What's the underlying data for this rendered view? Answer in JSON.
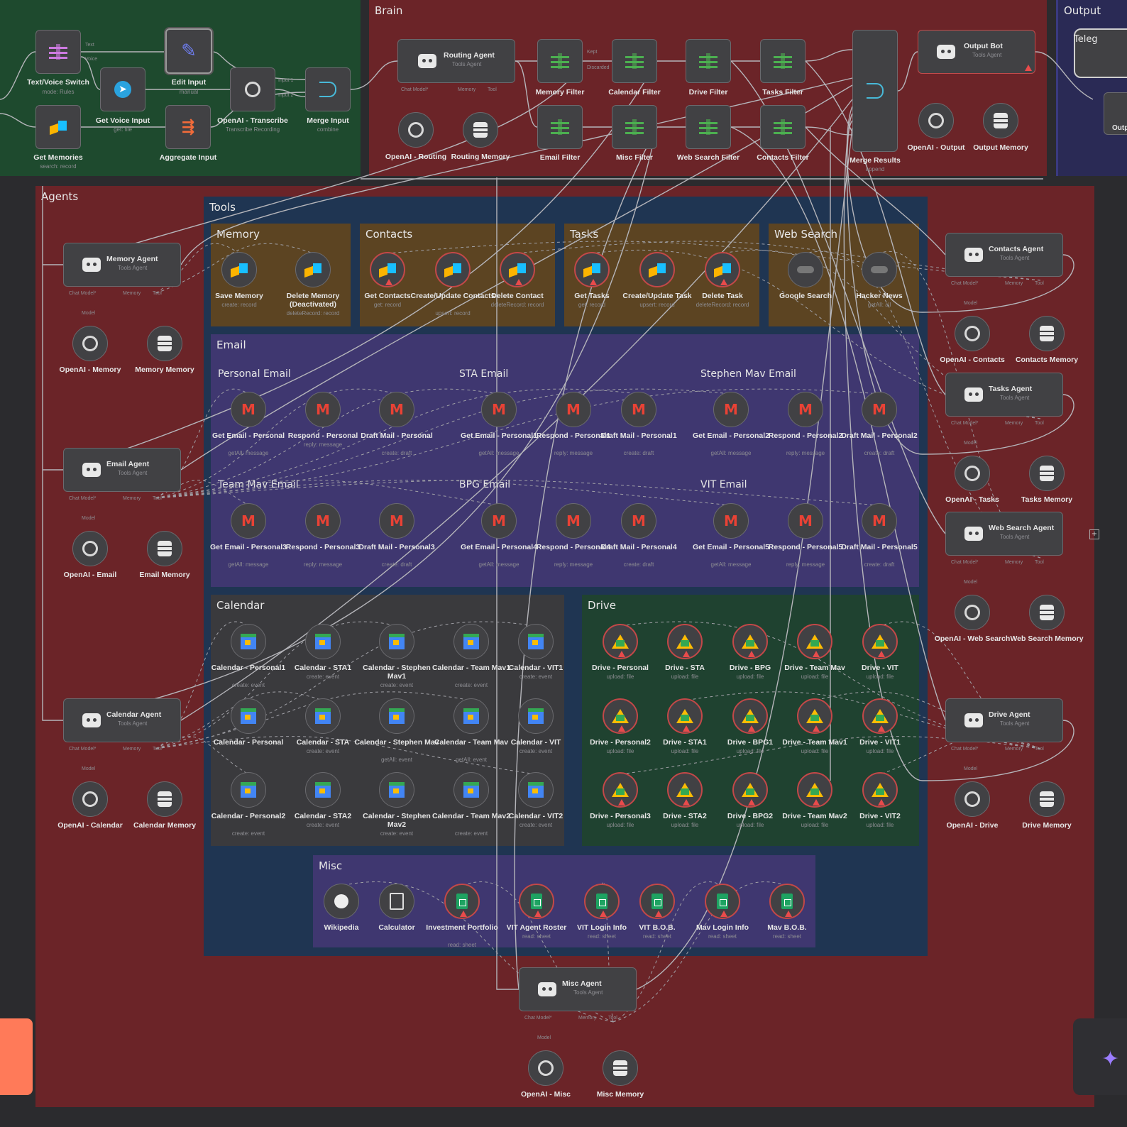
{
  "groups": {
    "brain": "Brain",
    "output": "Output",
    "telegram_partial": "Teleg",
    "output_partial": "Outp",
    "agents": "Agents",
    "tools": "Tools",
    "memory": "Memory",
    "contacts": "Contacts",
    "tasks": "Tasks",
    "web_search": "Web Search",
    "email": "Email",
    "personal_email": "Personal Email",
    "sta_email": "STA Email",
    "stephen_email": "Stephen Mav Email",
    "team_email": "Team Mav Email",
    "bpg_email": "BPG Email",
    "vit_email": "VIT Email",
    "calendar": "Calendar",
    "drive": "Drive",
    "misc": "Misc"
  },
  "input_nodes": {
    "text_voice_switch": "Text/Voice Switch",
    "text_voice_switch_sub": "mode: Rules",
    "get_voice_input": "Get Voice Input",
    "get_voice_input_sub": "get: file",
    "edit_input": "Edit Input",
    "edit_input_sub": "manual",
    "openai_transcribe": "OpenAI - Transcribe",
    "openai_transcribe_sub": "Transcribe Recording",
    "merge_input": "Merge Input",
    "merge_input_sub": "combine",
    "get_memories": "Get Memories",
    "get_memories_sub": "search: record",
    "aggregate_input": "Aggregate Input"
  },
  "brain_nodes": {
    "routing_agent": "Routing Agent",
    "routing_agent_sub": "Tools Agent",
    "openai_routing": "OpenAI - Routing",
    "routing_memory": "Routing Memory",
    "memory_filter": "Memory Filter",
    "calendar_filter": "Calendar Filter",
    "drive_filter": "Drive Filter",
    "tasks_filter": "Tasks Filter",
    "email_filter": "Email Filter",
    "misc_filter": "Misc Filter",
    "web_search_filter": "Web Search Filter",
    "contacts_filter": "Contacts Filter",
    "merge_results": "Merge Results",
    "merge_results_sub": "append",
    "output_bot": "Output Bot",
    "output_bot_sub": "Tools Agent",
    "openai_output": "OpenAI - Output",
    "output_memory": "Output Memory"
  },
  "port_labels": {
    "chat_model": "Chat Model*",
    "memory": "Memory",
    "tool": "Tool",
    "model": "Model",
    "kept": "Kept",
    "discarded": "Discarded",
    "input1": "Input 1",
    "input2": "Input 2",
    "text": "Text",
    "voice": "Voice"
  },
  "agents": {
    "memory_agent": "Memory Agent",
    "email_agent": "Email Agent",
    "calendar_agent": "Calendar Agent",
    "contacts_agent": "Contacts Agent",
    "tasks_agent": "Tasks Agent",
    "web_search_agent": "Web Search Agent",
    "drive_agent": "Drive Agent",
    "misc_agent": "Misc Agent",
    "sub": "Tools Agent",
    "openai_memory": "OpenAI - Memory",
    "memory_memory": "Memory Memory",
    "openai_email": "OpenAI - Email",
    "email_memory": "Email Memory",
    "openai_calendar": "OpenAI - Calendar",
    "calendar_memory": "Calendar Memory",
    "openai_contacts": "OpenAI - Contacts",
    "contacts_memory": "Contacts Memory",
    "openai_tasks": "OpenAI - Tasks",
    "tasks_memory": "Tasks Memory",
    "openai_web": "OpenAI - Web Search",
    "web_memory": "Web Search Memory",
    "openai_drive": "OpenAI - Drive",
    "drive_memory": "Drive Memory",
    "openai_misc": "OpenAI - Misc",
    "misc_memory": "Misc Memory"
  },
  "tools": {
    "memory": [
      {
        "label": "Save Memory",
        "sub": "create: record"
      },
      {
        "label": "Delete Memory (Deactivated)",
        "sub": "deleteRecord: record"
      }
    ],
    "contacts": [
      {
        "label": "Get Contacts",
        "sub": "get: record"
      },
      {
        "label": "Create/Update Contacts",
        "sub": "upsert: record"
      },
      {
        "label": "Delete Contact",
        "sub": "deleteRecord: record"
      }
    ],
    "tasks": [
      {
        "label": "Get Tasks",
        "sub": "get: record"
      },
      {
        "label": "Create/Update Task",
        "sub": "upsert: record"
      },
      {
        "label": "Delete Task",
        "sub": "deleteRecord: record"
      }
    ],
    "web": [
      {
        "label": "Google Search",
        "sub": ""
      },
      {
        "label": "Hacker News",
        "sub": "getAll: all"
      }
    ],
    "personal_email": [
      {
        "label": "Get Email - Personal",
        "sub": "getAll: message"
      },
      {
        "label": "Respond - Personal",
        "sub": "reply: message"
      },
      {
        "label": "Draft Mail - Personal",
        "sub": "create: draft"
      }
    ],
    "sta_email": [
      {
        "label": "Get Email - Personal1",
        "sub": "getAll: message"
      },
      {
        "label": "Respond - Personal1",
        "sub": "reply: message"
      },
      {
        "label": "Draft Mail - Personal1",
        "sub": "create: draft"
      }
    ],
    "stephen_email": [
      {
        "label": "Get Email - Personal2",
        "sub": "getAll: message"
      },
      {
        "label": "Respond - Personal2",
        "sub": "reply: message"
      },
      {
        "label": "Draft Mail - Personal2",
        "sub": "create: draft"
      }
    ],
    "team_email": [
      {
        "label": "Get Email - Personal3",
        "sub": "getAll: message"
      },
      {
        "label": "Respond - Personal3",
        "sub": "reply: message"
      },
      {
        "label": "Draft Mail - Personal3",
        "sub": "create: draft"
      }
    ],
    "bpg_email": [
      {
        "label": "Get Email - Personal4",
        "sub": "getAll: message"
      },
      {
        "label": "Respond - Personal4",
        "sub": "reply: message"
      },
      {
        "label": "Draft Mail - Personal4",
        "sub": "create: draft"
      }
    ],
    "vit_email": [
      {
        "label": "Get Email - Personal5",
        "sub": "getAll: message"
      },
      {
        "label": "Respond - Personal5",
        "sub": "reply: message"
      },
      {
        "label": "Draft Mail - Personal5",
        "sub": "create: draft"
      }
    ],
    "calendar_row1": [
      {
        "label": "Calendar - Personal1",
        "sub": "create: event"
      },
      {
        "label": "Calendar - STA1",
        "sub": "create: event"
      },
      {
        "label": "Calendar - Stephen Mav1",
        "sub": "create: event"
      },
      {
        "label": "Calendar - Team Mav1",
        "sub": "create: event"
      },
      {
        "label": "Calendar - VIT1",
        "sub": "create: event"
      }
    ],
    "calendar_row2": [
      {
        "label": "Calendar - Personal",
        "sub": ""
      },
      {
        "label": "Calendar - STA",
        "sub": "create: event"
      },
      {
        "label": "Calendar - Stephen Mav",
        "sub": "getAll: event"
      },
      {
        "label": "Calendar - Team Mav",
        "sub": "getAll: event"
      },
      {
        "label": "Calendar - VIT",
        "sub": "create: event"
      }
    ],
    "calendar_row3": [
      {
        "label": "Calendar - Personal2",
        "sub": "create: event"
      },
      {
        "label": "Calendar - STA2",
        "sub": "create: event"
      },
      {
        "label": "Calendar - Stephen Mav2",
        "sub": "create: event"
      },
      {
        "label": "Calendar - Team Mav2",
        "sub": "create: event"
      },
      {
        "label": "Calendar - VIT2",
        "sub": "create: event"
      }
    ],
    "drive_row1": [
      {
        "label": "Drive - Personal",
        "sub": "upload: file"
      },
      {
        "label": "Drive - STA",
        "sub": "upload: file"
      },
      {
        "label": "Drive - BPG",
        "sub": "upload: file"
      },
      {
        "label": "Drive - Team Mav",
        "sub": "upload: file"
      },
      {
        "label": "Drive - VIT",
        "sub": "upload: file"
      }
    ],
    "drive_row2": [
      {
        "label": "Drive - Personal2",
        "sub": "upload: file"
      },
      {
        "label": "Drive - STA1",
        "sub": "upload: file"
      },
      {
        "label": "Drive - BPG1",
        "sub": "upload: file"
      },
      {
        "label": "Drive - Team Mav1",
        "sub": "upload: file"
      },
      {
        "label": "Drive - VIT1",
        "sub": "upload: file"
      }
    ],
    "drive_row3": [
      {
        "label": "Drive - Personal3",
        "sub": "upload: file"
      },
      {
        "label": "Drive - STA2",
        "sub": "upload: file"
      },
      {
        "label": "Drive - BPG2",
        "sub": "upload: file"
      },
      {
        "label": "Drive - Team Mav2",
        "sub": "upload: file"
      },
      {
        "label": "Drive - VIT2",
        "sub": "upload: file"
      }
    ],
    "misc": [
      {
        "label": "Wikipedia",
        "sub": ""
      },
      {
        "label": "Calculator",
        "sub": ""
      },
      {
        "label": "Investment Portfolio",
        "sub": "read: sheet"
      },
      {
        "label": "VIT Agent Roster",
        "sub": "read: sheet"
      },
      {
        "label": "VIT Login Info",
        "sub": "read: sheet"
      },
      {
        "label": "VIT B.O.B.",
        "sub": "read: sheet"
      },
      {
        "label": "Mav Login Info",
        "sub": "read: sheet"
      },
      {
        "label": "Mav B.O.B.",
        "sub": "read: sheet"
      }
    ]
  },
  "colors": {
    "canvas": "#2b2b2e",
    "input_group": "#1e4a2e",
    "brain_group": "#6b2428",
    "agents_group": "#6b2428",
    "tools_group": "#1f3552",
    "orange_group": "#5c4422",
    "email_group": "#3f3770",
    "calendar_group": "#3a3a3d",
    "drive_group": "#1f4230",
    "node": "#414144"
  }
}
